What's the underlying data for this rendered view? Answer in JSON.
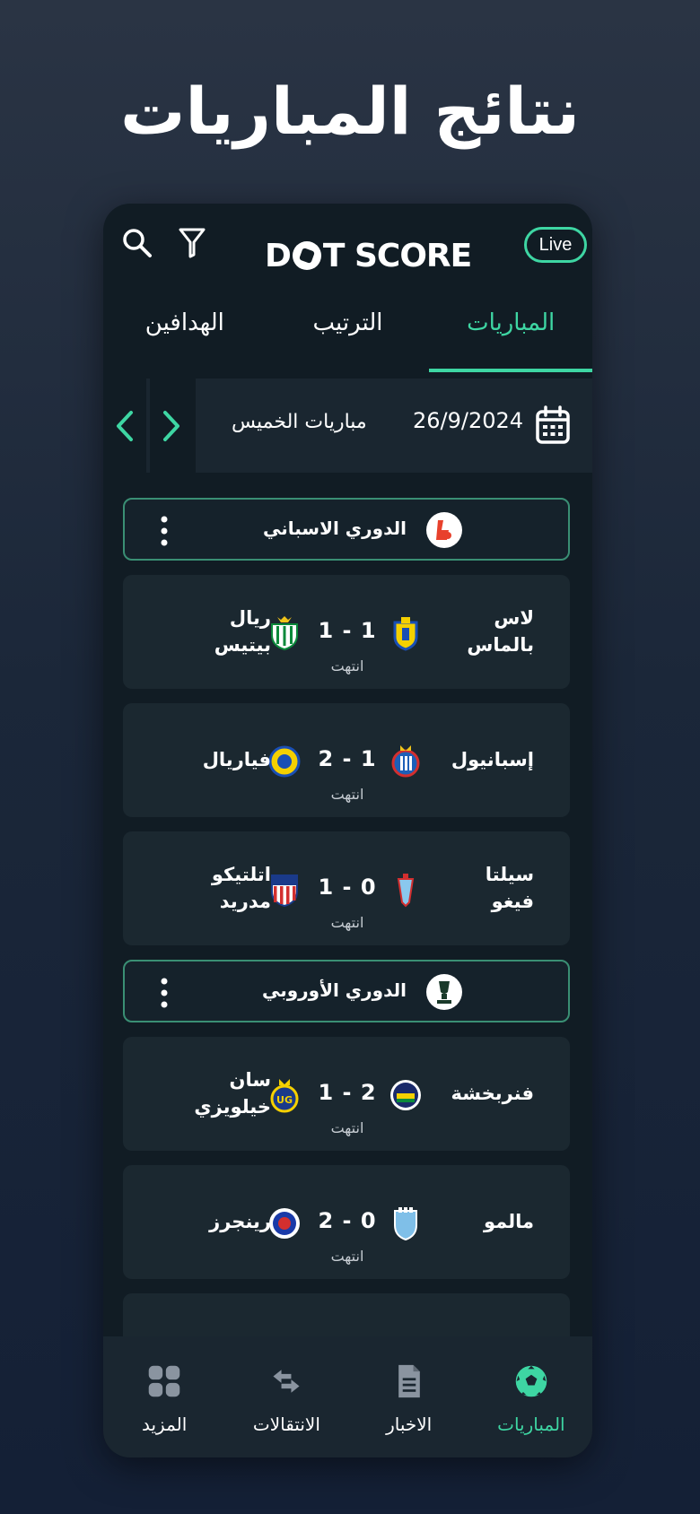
{
  "headline": "نتائج المباريات",
  "header": {
    "logo_left": "D",
    "logo_right": "T SCORE",
    "live_label": "Live",
    "accent": "#3ed6a3"
  },
  "tabs": [
    {
      "label": "المباريات",
      "active": true
    },
    {
      "label": "الترتيب",
      "active": false
    },
    {
      "label": "الهدافين",
      "active": false
    }
  ],
  "datebar": {
    "date": "26/9/2024",
    "day_label": "مباريات الخميس"
  },
  "leagues": [
    {
      "name": "الدوري الاسباني",
      "matches": [
        {
          "home": "لاس\nبالماس",
          "away": "ريال بيتيس",
          "score": "1 - 1",
          "status": "انتهت"
        },
        {
          "home": "إسبانيول",
          "away": "فياريال",
          "score": "2 - 1",
          "status": "انتهت"
        },
        {
          "home": "سيلتا فيغو",
          "away": "اتلتيكو\nمدريد",
          "score": "1 - 0",
          "status": "انتهت"
        }
      ]
    },
    {
      "name": "الدوري الأوروبي",
      "matches": [
        {
          "home": "فنربخشة",
          "away": "سان\nخيلويزي",
          "score": "1 - 2",
          "status": "انتهت"
        },
        {
          "home": "مالمو",
          "away": "رينجرز",
          "score": "2 - 0",
          "status": "انتهت"
        }
      ]
    }
  ],
  "bottom_nav": [
    {
      "label": "المباريات",
      "icon": "soccer-ball-icon",
      "active": true
    },
    {
      "label": "الاخبار",
      "icon": "document-icon",
      "active": false
    },
    {
      "label": "الانتقالات",
      "icon": "transfer-arrows-icon",
      "active": false
    },
    {
      "label": "المزيد",
      "icon": "grid-icon",
      "active": false
    }
  ]
}
